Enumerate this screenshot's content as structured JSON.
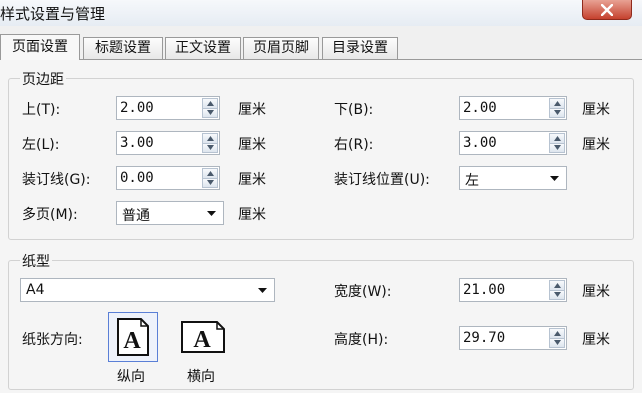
{
  "window": {
    "title": "样式设置与管理"
  },
  "tabs": [
    {
      "label": "页面设置",
      "active": true
    },
    {
      "label": "标题设置",
      "active": false
    },
    {
      "label": "正文设置",
      "active": false
    },
    {
      "label": "页眉页脚",
      "active": false
    },
    {
      "label": "目录设置",
      "active": false
    }
  ],
  "margins": {
    "title": "页边距",
    "top": {
      "label": "上(T):",
      "value": "2.00",
      "unit": "厘米"
    },
    "bottom": {
      "label": "下(B):",
      "value": "2.00",
      "unit": "厘米"
    },
    "left": {
      "label": "左(L):",
      "value": "3.00",
      "unit": "厘米"
    },
    "right": {
      "label": "右(R):",
      "value": "3.00",
      "unit": "厘米"
    },
    "gutter": {
      "label": "装订线(G):",
      "value": "0.00",
      "unit": "厘米"
    },
    "gutter_position": {
      "label": "装订线位置(U):",
      "value": "左"
    },
    "multiple_pages": {
      "label": "多页(M):",
      "value": "普通",
      "unit": "厘米"
    }
  },
  "paper": {
    "title": "纸型",
    "size": "A4",
    "width": {
      "label": "宽度(W):",
      "value": "21.00",
      "unit": "厘米"
    },
    "height": {
      "label": "高度(H):",
      "value": "29.70",
      "unit": "厘米"
    },
    "orientation_label": "纸张方向:",
    "portrait": {
      "label": "纵向",
      "glyph": "A",
      "selected": true
    },
    "landscape": {
      "label": "横向",
      "glyph": "A",
      "selected": false
    }
  },
  "colors": {
    "close_button": "#c5412e",
    "selection_border": "#5a7fd6"
  },
  "icons": {
    "close": "close-icon",
    "spin_up": "triangle-up-icon",
    "spin_down": "triangle-down-icon",
    "dropdown": "chevron-down-icon",
    "portrait": "portrait-page-icon",
    "landscape": "landscape-page-icon"
  }
}
